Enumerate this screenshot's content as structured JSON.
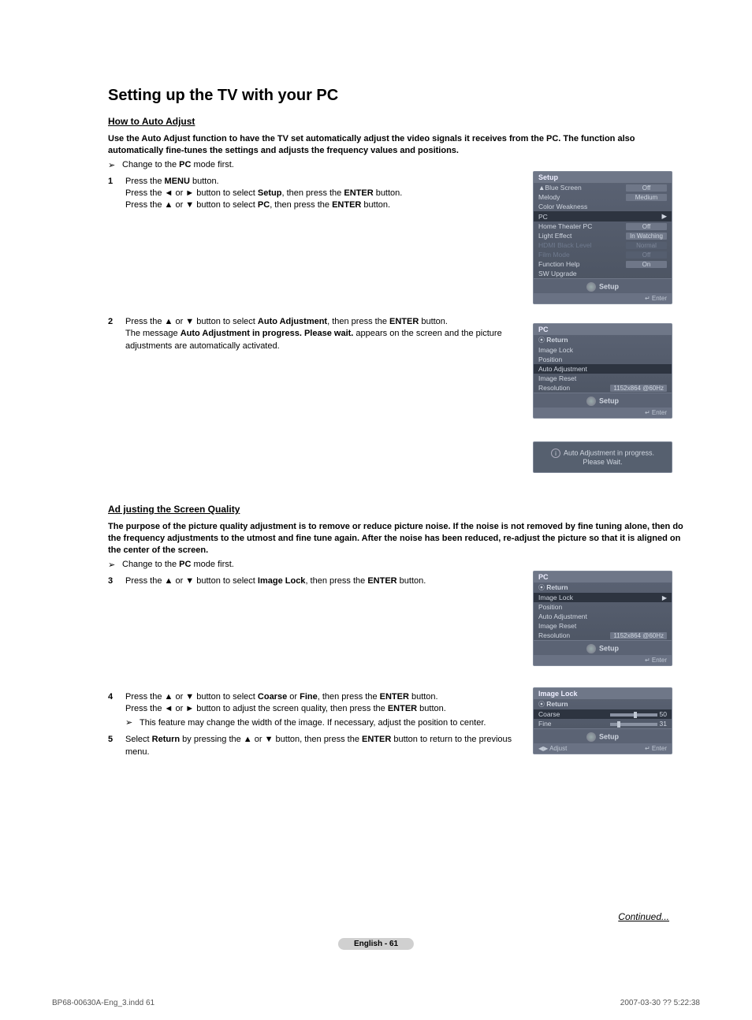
{
  "title": "Setting up the TV with your PC",
  "section1": {
    "heading": "How to Auto Adjust",
    "intro": "Use the Auto Adjust function to have the TV set automatically adjust the video signals it receives from the PC. The function also automatically fine-tunes the settings and adjusts the frequency values and positions.",
    "note_before": "Change to the ",
    "note_bold": "PC",
    "note_after": " mode first.",
    "step1_num": "1",
    "step1_l1a": "Press the ",
    "step1_l1b": "MENU",
    "step1_l1c": " button.",
    "step1_l2a": "Press the ◄ or ► button to select ",
    "step1_l2b": "Setup",
    "step1_l2c": ", then press the ",
    "step1_l2d": "ENTER",
    "step1_l2e": " button.",
    "step1_l3a": "Press the ▲ or ▼ button to select ",
    "step1_l3b": "PC",
    "step1_l3c": ", then press the ",
    "step1_l3d": "ENTER",
    "step1_l3e": " button.",
    "step2_num": "2",
    "step2_l1a": "Press the ▲ or ▼ button to select ",
    "step2_l1b": "Auto Adjustment",
    "step2_l1c": ", then press the ",
    "step2_l1d": "ENTER",
    "step2_l1e": " button.",
    "step2_l2a": "The message ",
    "step2_l2b": "Auto Adjustment in progress. Please wait.",
    "step2_l2c": " appears on the screen and the picture adjustments are automatically activated."
  },
  "section2": {
    "heading": "Ad justing the Screen Quality",
    "intro": "The purpose of the picture quality adjustment is to remove or reduce picture noise. If the noise is not removed by fine tuning alone, then do the frequency adjustments to the utmost and fine tune again. After the noise has been reduced, re-adjust the picture so that it is aligned on the center of the screen.",
    "note_before": "Change to the ",
    "note_bold": "PC",
    "note_after": " mode first.",
    "step3_num": "3",
    "step3_a": "Press the ▲ or ▼ button to select ",
    "step3_b": "Image Lock",
    "step3_c": ", then press the ",
    "step3_d": "ENTER",
    "step3_e": " button.",
    "step4_num": "4",
    "step4_l1a": "Press the ▲ or ▼ button to select ",
    "step4_l1b": "Coarse",
    "step4_l1c": " or ",
    "step4_l1d": "Fine",
    "step4_l1e": ", then press the ",
    "step4_l1f": "ENTER",
    "step4_l1g": " button.",
    "step4_l2a": "Press the ◄ or ► button to adjust the screen quality, then press the ",
    "step4_l2b": "ENTER",
    "step4_l2c": " button.",
    "step4_sub": "This feature may change the width of the image. If necessary, adjust the position to center.",
    "step5_num": "5",
    "step5_a": "Select ",
    "step5_b": "Return",
    "step5_c": " by pressing the ▲ or ▼ button, then press the ",
    "step5_d": "ENTER",
    "step5_e": " button to return to the previous menu."
  },
  "osd1": {
    "title": "Setup",
    "rows": [
      {
        "label": "▲Blue Screen",
        "val": "Off"
      },
      {
        "label": "Melody",
        "val": "Medium"
      },
      {
        "label": "Color Weakness",
        "val": ""
      },
      {
        "label": "PC",
        "val": "▶",
        "sel": true
      },
      {
        "label": "Home Theater PC",
        "val": "Off"
      },
      {
        "label": "Light Effect",
        "val": "In Watching"
      },
      {
        "label": "HDMI Black Level",
        "val": "Normal",
        "dim": true
      },
      {
        "label": "Film Mode",
        "val": "Off",
        "dim": true
      },
      {
        "label": "Function Help",
        "val": "On"
      },
      {
        "label": "SW Upgrade",
        "val": ""
      }
    ],
    "foot": "Setup",
    "enter": "Enter"
  },
  "osd2": {
    "title": "PC",
    "ret": "Return",
    "rows": [
      {
        "label": "Image Lock"
      },
      {
        "label": "Position"
      },
      {
        "label": "Auto Adjustment",
        "sel": true
      },
      {
        "label": "Image Reset"
      },
      {
        "label": "Resolution",
        "val": "1152x864 @60Hz"
      }
    ],
    "foot": "Setup",
    "enter": "Enter"
  },
  "info": "Auto Adjustment in progress.\nPlease Wait.",
  "osd3": {
    "title": "PC",
    "ret": "Return",
    "rows": [
      {
        "label": "Image Lock",
        "sel": true,
        "arrow": true
      },
      {
        "label": "Position"
      },
      {
        "label": "Auto Adjustment"
      },
      {
        "label": "Image Reset"
      },
      {
        "label": "Resolution",
        "val": "1152x864 @60Hz"
      }
    ],
    "foot": "Setup",
    "enter": "Enter"
  },
  "osd4": {
    "title": "Image Lock",
    "ret": "Return",
    "coarse_label": "Coarse",
    "coarse_val": "50",
    "fine_label": "Fine",
    "fine_val": "31",
    "foot": "Setup",
    "adjust": "Adjust",
    "enter": "Enter"
  },
  "continued": "Continued...",
  "page_lang": "English - 61",
  "footer_left": "BP68-00630A-Eng_3.indd   61",
  "footer_right": "2007-03-30   ?? 5:22:38"
}
